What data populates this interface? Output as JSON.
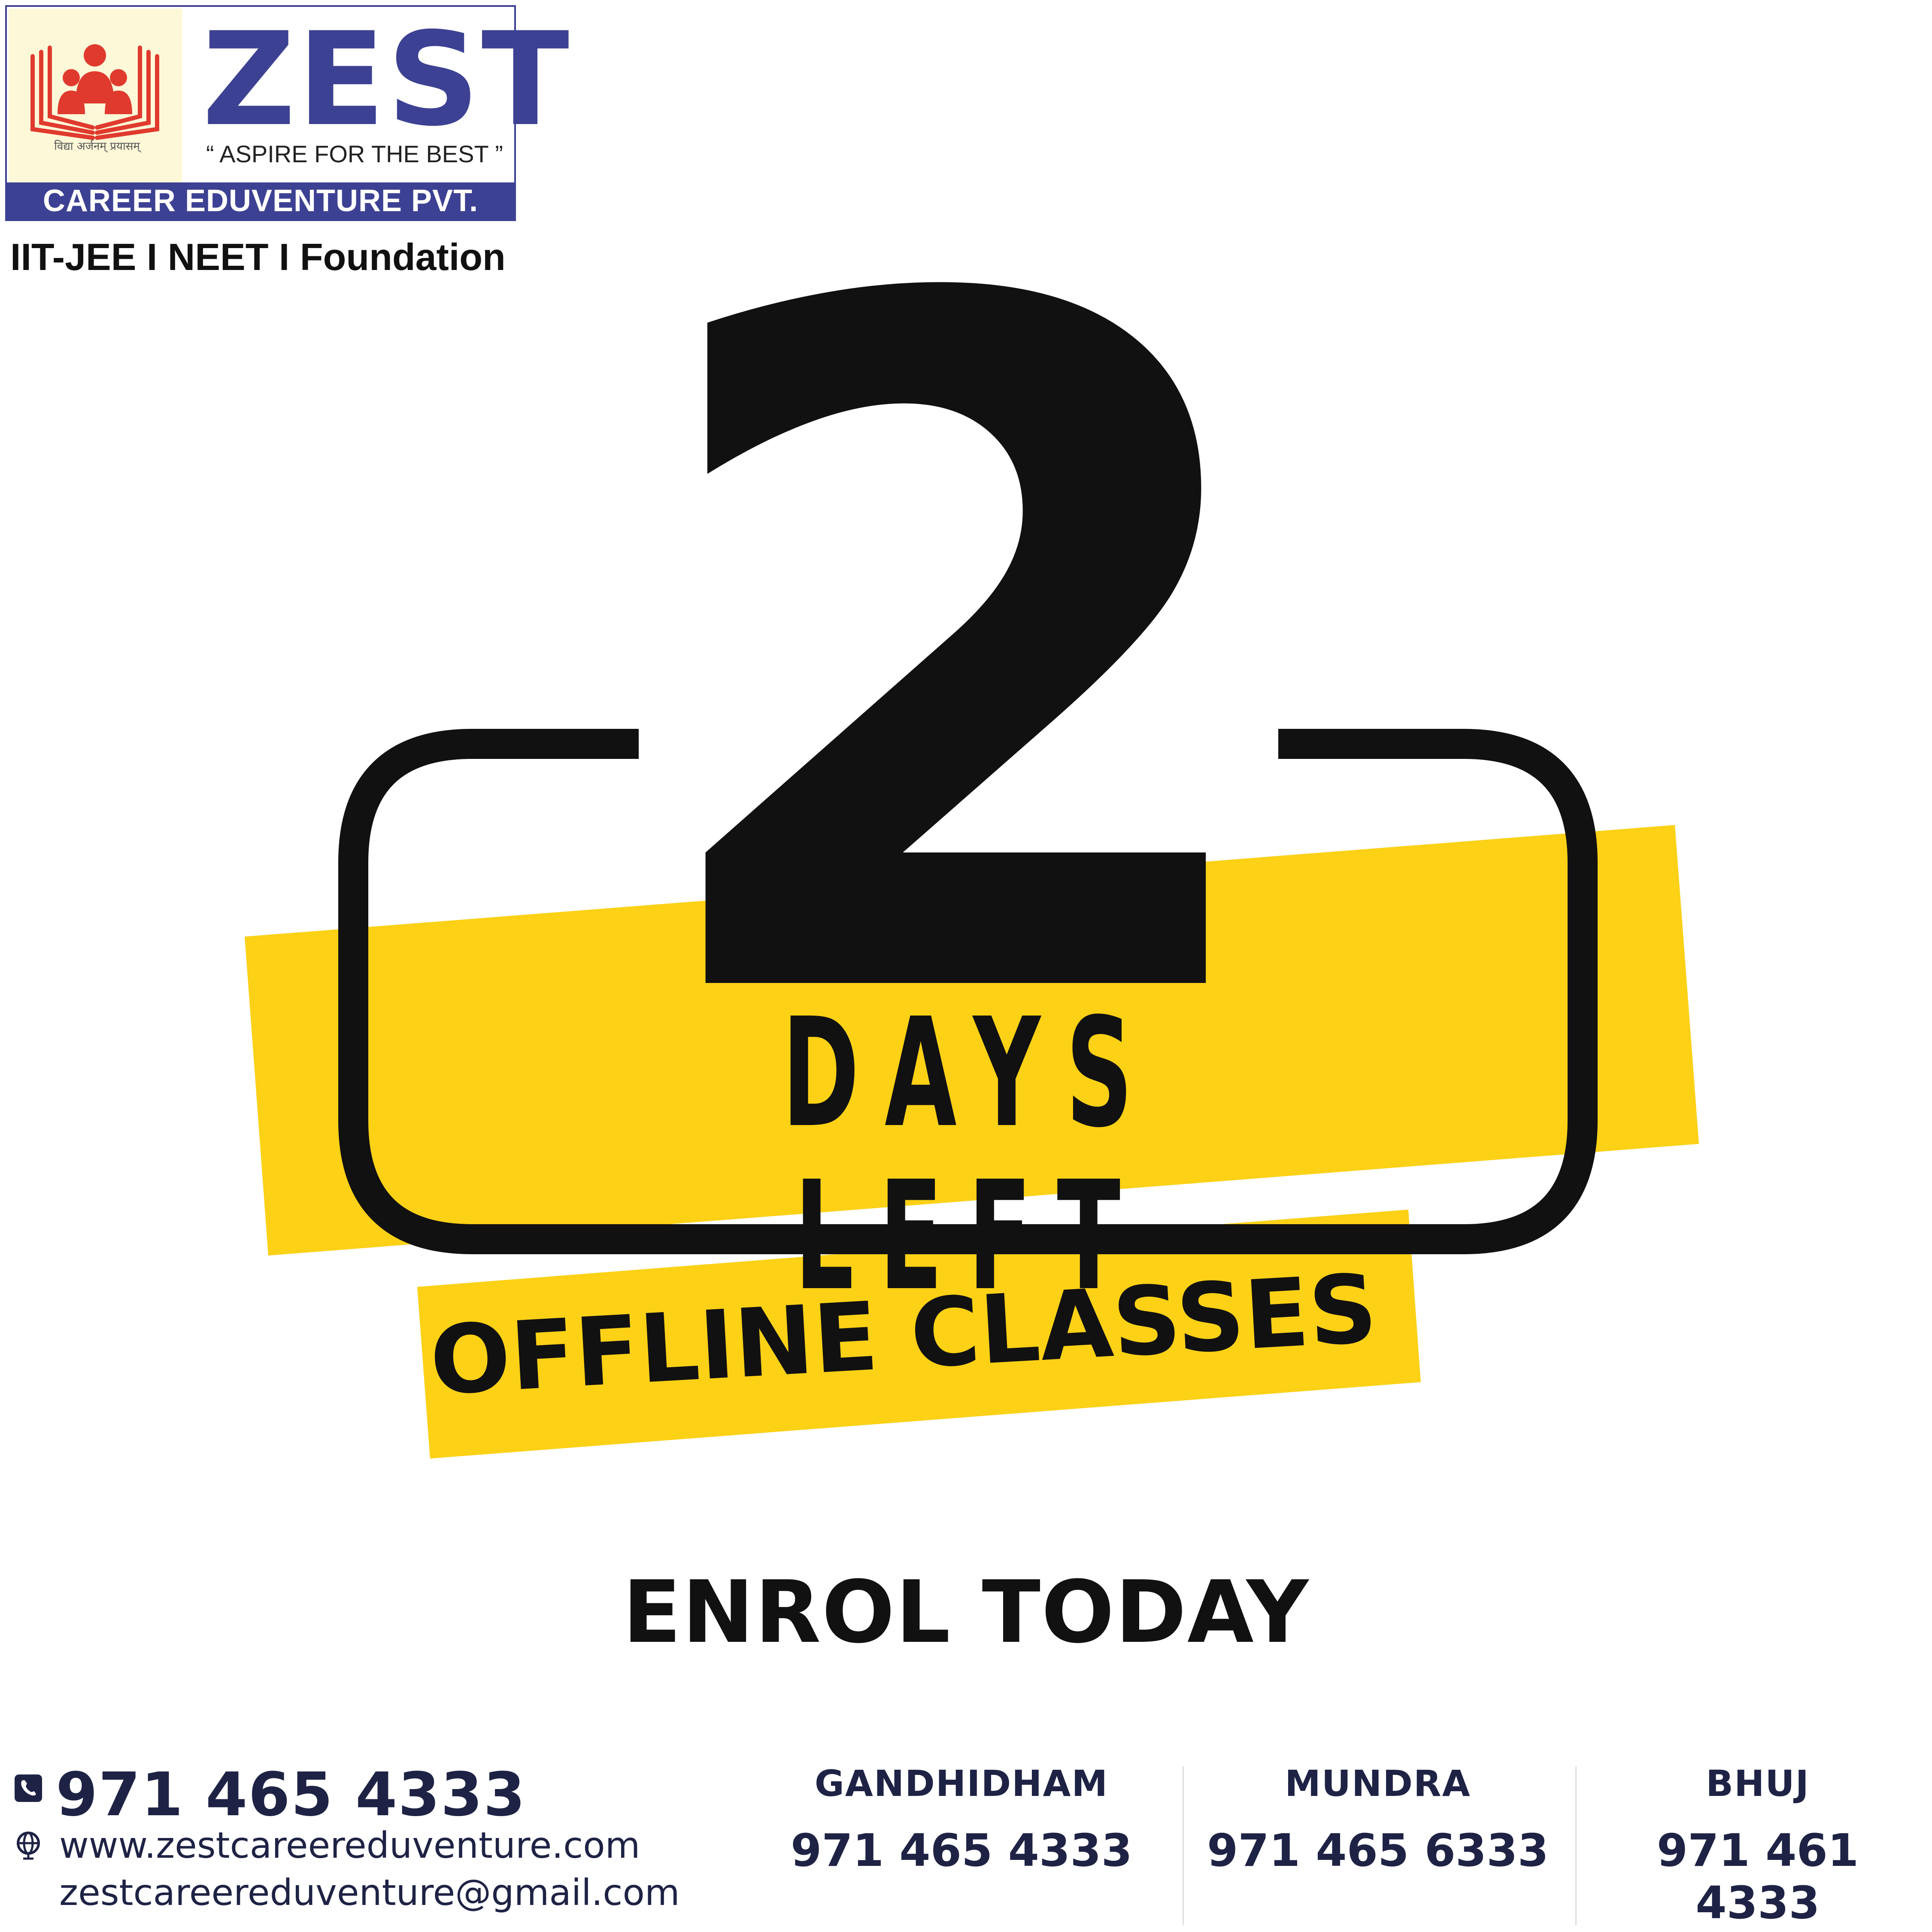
{
  "logo": {
    "brand": "ZEST",
    "tagline": "“ ASPIRE FOR THE BEST ”",
    "company": "CAREER EDUVENTURE PVT. LTD.",
    "motto": "विद्या अर्जनम् प्रयासम्",
    "courses": "IIT-JEE I NEET I Foundation"
  },
  "graphic": {
    "number": "2",
    "days_left": "DAYS LEFT",
    "offline_classes": "OFFLINE CLASSES"
  },
  "cta": {
    "enrol": "ENROL TODAY"
  },
  "contact": {
    "phone": "971 465 4333",
    "website": "www.zestcareereduventure.com",
    "email": "zestcareereduventure@gmail.com",
    "phone_icon": "phone-icon",
    "globe_icon": "globe-icon"
  },
  "branches": [
    {
      "name": "GANDHIDHAM",
      "phone": "971 465 4333"
    },
    {
      "name": "MUNDRA",
      "phone": "971 465 6333"
    },
    {
      "name": "BHUJ",
      "phone": "971 461 4333"
    }
  ],
  "colors": {
    "brand_blue": "#3d4193",
    "accent_yellow": "#fcd116",
    "text_dark": "#111111",
    "footer_navy": "#1e2345",
    "emblem_red": "#e03a2e",
    "emblem_bg": "#fdf8d8"
  }
}
